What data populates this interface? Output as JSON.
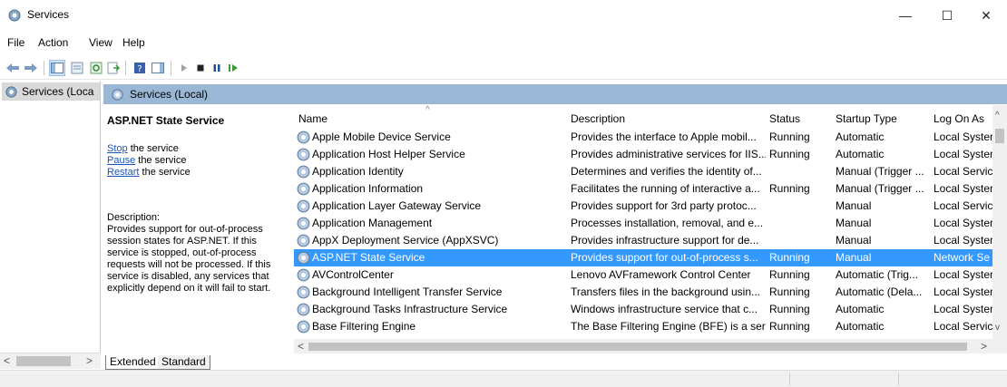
{
  "window": {
    "title": "Services",
    "minimize": "—",
    "maximize": "☐",
    "close": "✕"
  },
  "menu": [
    "File",
    "Action",
    "View",
    "Help"
  ],
  "toolbar": [
    "back-icon",
    "forward-icon",
    "show-hide-console-tree-icon",
    "properties-icon",
    "refresh-icon",
    "export-list-icon",
    "help-icon",
    "show-action-pane-icon",
    "start-service-icon",
    "stop-service-icon",
    "pause-service-icon",
    "restart-service-icon"
  ],
  "tree": {
    "node_label": "Services (Loca"
  },
  "pane": {
    "header_label": "Services (Local)"
  },
  "details": {
    "service_title": "ASP.NET State Service",
    "stop_link": "Stop",
    "stop_suffix": " the service",
    "pause_link": "Pause",
    "pause_suffix": " the service",
    "restart_link": "Restart",
    "restart_suffix": " the service",
    "description_label": "Description:",
    "description_text": "Provides support for out-of-process session states for ASP.NET. If this service is stopped, out-of-process requests will not be processed. If this service is disabled, any services that explicitly depend on it will fail to start."
  },
  "table": {
    "columns": {
      "name": "Name",
      "description": "Description",
      "status": "Status",
      "startup": "Startup Type",
      "logon": "Log On As"
    },
    "rows": [
      {
        "name": "Apple Mobile Device Service",
        "description": "Provides the interface to Apple mobil...",
        "status": "Running",
        "startup": "Automatic",
        "logon": "Local Syster"
      },
      {
        "name": "Application Host Helper Service",
        "description": "Provides administrative services for IIS...",
        "status": "Running",
        "startup": "Automatic",
        "logon": "Local Syster"
      },
      {
        "name": "Application Identity",
        "description": "Determines and verifies the identity of...",
        "status": "",
        "startup": "Manual (Trigger ...",
        "logon": "Local Servic"
      },
      {
        "name": "Application Information",
        "description": "Facilitates the running of interactive a...",
        "status": "Running",
        "startup": "Manual (Trigger ...",
        "logon": "Local Syster"
      },
      {
        "name": "Application Layer Gateway Service",
        "description": "Provides support for 3rd party protoc...",
        "status": "",
        "startup": "Manual",
        "logon": "Local Servic"
      },
      {
        "name": "Application Management",
        "description": "Processes installation, removal, and e...",
        "status": "",
        "startup": "Manual",
        "logon": "Local Syster"
      },
      {
        "name": "AppX Deployment Service (AppXSVC)",
        "description": "Provides infrastructure support for de...",
        "status": "",
        "startup": "Manual",
        "logon": "Local Syster"
      },
      {
        "name": "ASP.NET State Service",
        "description": "Provides support for out-of-process s...",
        "status": "Running",
        "startup": "Manual",
        "logon": "Network Se"
      },
      {
        "name": "AVControlCenter",
        "description": "Lenovo AVFramework Control Center",
        "status": "Running",
        "startup": "Automatic (Trig...",
        "logon": "Local Syster"
      },
      {
        "name": "Background Intelligent Transfer Service",
        "description": "Transfers files in the background usin...",
        "status": "Running",
        "startup": "Automatic (Dela...",
        "logon": "Local Syster"
      },
      {
        "name": "Background Tasks Infrastructure Service",
        "description": "Windows infrastructure service that c...",
        "status": "Running",
        "startup": "Automatic",
        "logon": "Local Syster"
      },
      {
        "name": "Base Filtering Engine",
        "description": "The Base Filtering Engine (BFE) is a ser...",
        "status": "Running",
        "startup": "Automatic",
        "logon": "Local Servic"
      }
    ],
    "selected_row": 7
  },
  "tabs": {
    "extended": "Extended",
    "standard": "Standard"
  },
  "colors": {
    "selection": "#3399ff",
    "pane_header": "#9ab8d6",
    "link": "#1a56b8",
    "tree_selected": "#d9d9d9"
  }
}
